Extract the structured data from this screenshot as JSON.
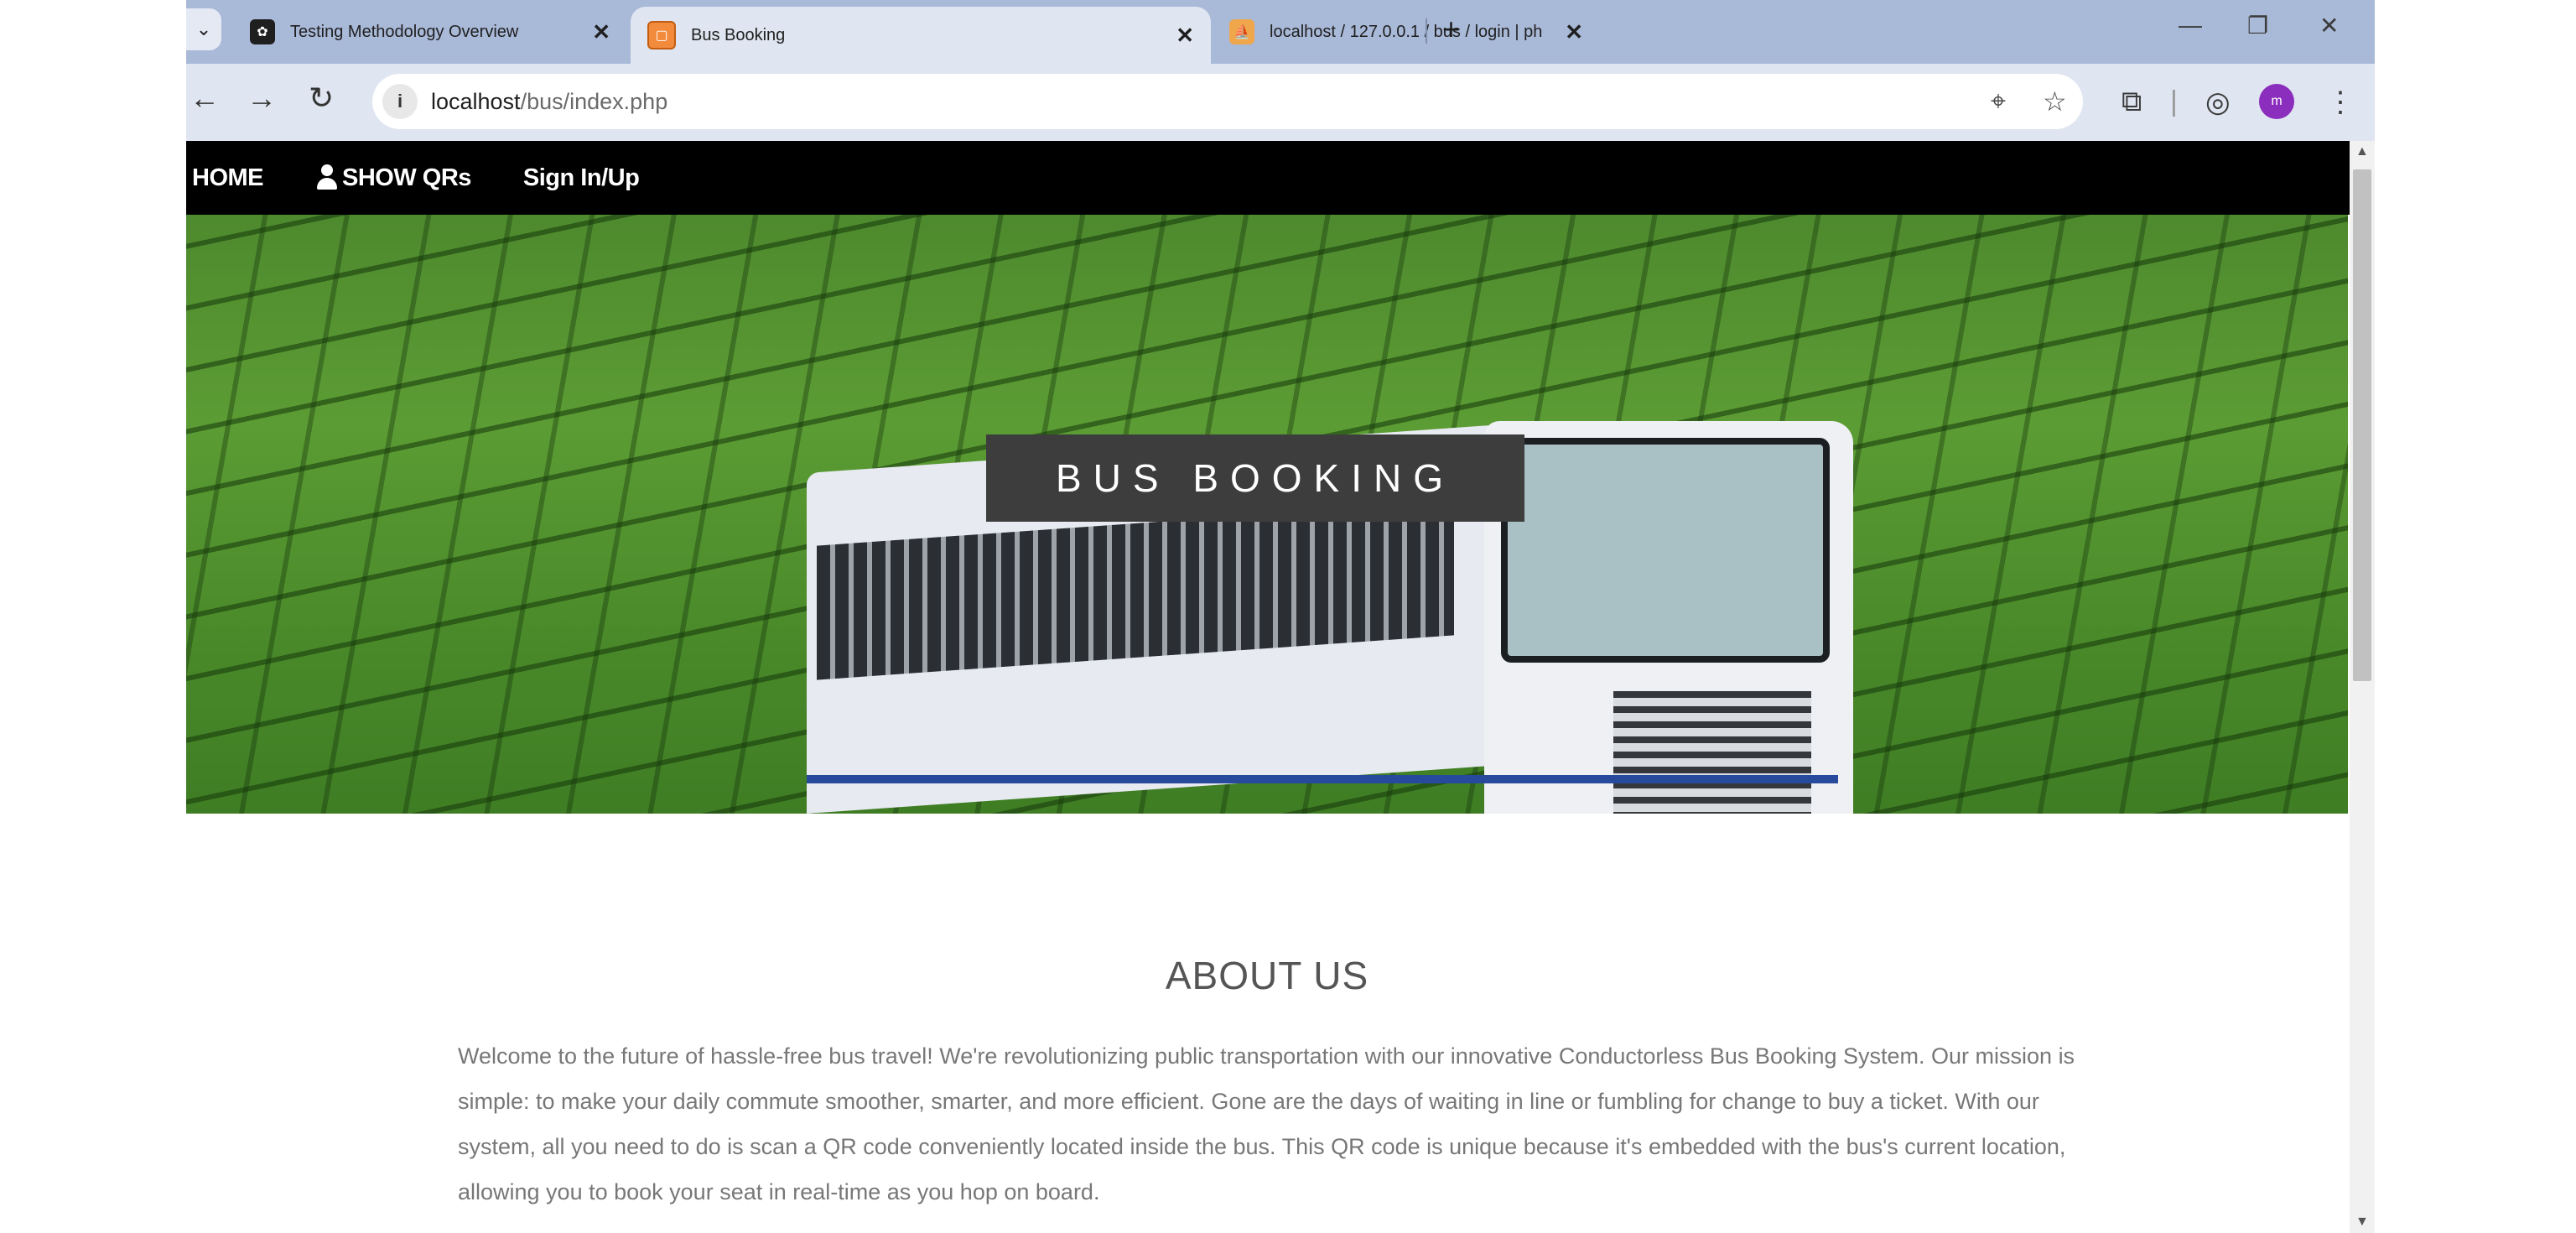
{
  "browser": {
    "tabs": [
      {
        "title": "Testing Methodology Overview",
        "active": false,
        "favicon": "chatgpt-icon"
      },
      {
        "title": "Bus Booking",
        "active": true,
        "favicon": "page-icon"
      },
      {
        "title": "localhost / 127.0.0.1 / bus / login | ph",
        "active": false,
        "favicon": "phpmyadmin-icon"
      }
    ],
    "new_tab_label": "+",
    "window_controls": {
      "minimize": "—",
      "maximize": "❐",
      "close": "✕"
    },
    "address": {
      "host": "localhost",
      "path": "/bus/index.php"
    },
    "avatar_initial": "m"
  },
  "site": {
    "nav": [
      {
        "label": "HOME"
      },
      {
        "label": "SHOW QRs",
        "icon": "user-icon"
      },
      {
        "label": "Sign In/Up"
      }
    ],
    "hero_title": "BUS BOOKING",
    "about_heading": "ABOUT US",
    "about_text": "Welcome to the future of hassle-free bus travel! We're revolutionizing public transportation with our innovative Conductorless Bus Booking System. Our mission is simple: to make your daily commute smoother, smarter, and more efficient. Gone are the days of waiting in line or fumbling for change to buy a ticket. With our system, all you need to do is scan a QR code conveniently located inside the bus. This QR code is unique because it's embedded with the bus's current location, allowing you to book your seat in real-time as you hop on board."
  },
  "colors": {
    "tabstrip_bg": "#a9b9d8",
    "toolbar_bg": "#dfe5f1",
    "nav_bg": "#000000",
    "title_box_bg": "#3d3d3d",
    "avatar_bg": "#8b2dbd"
  }
}
